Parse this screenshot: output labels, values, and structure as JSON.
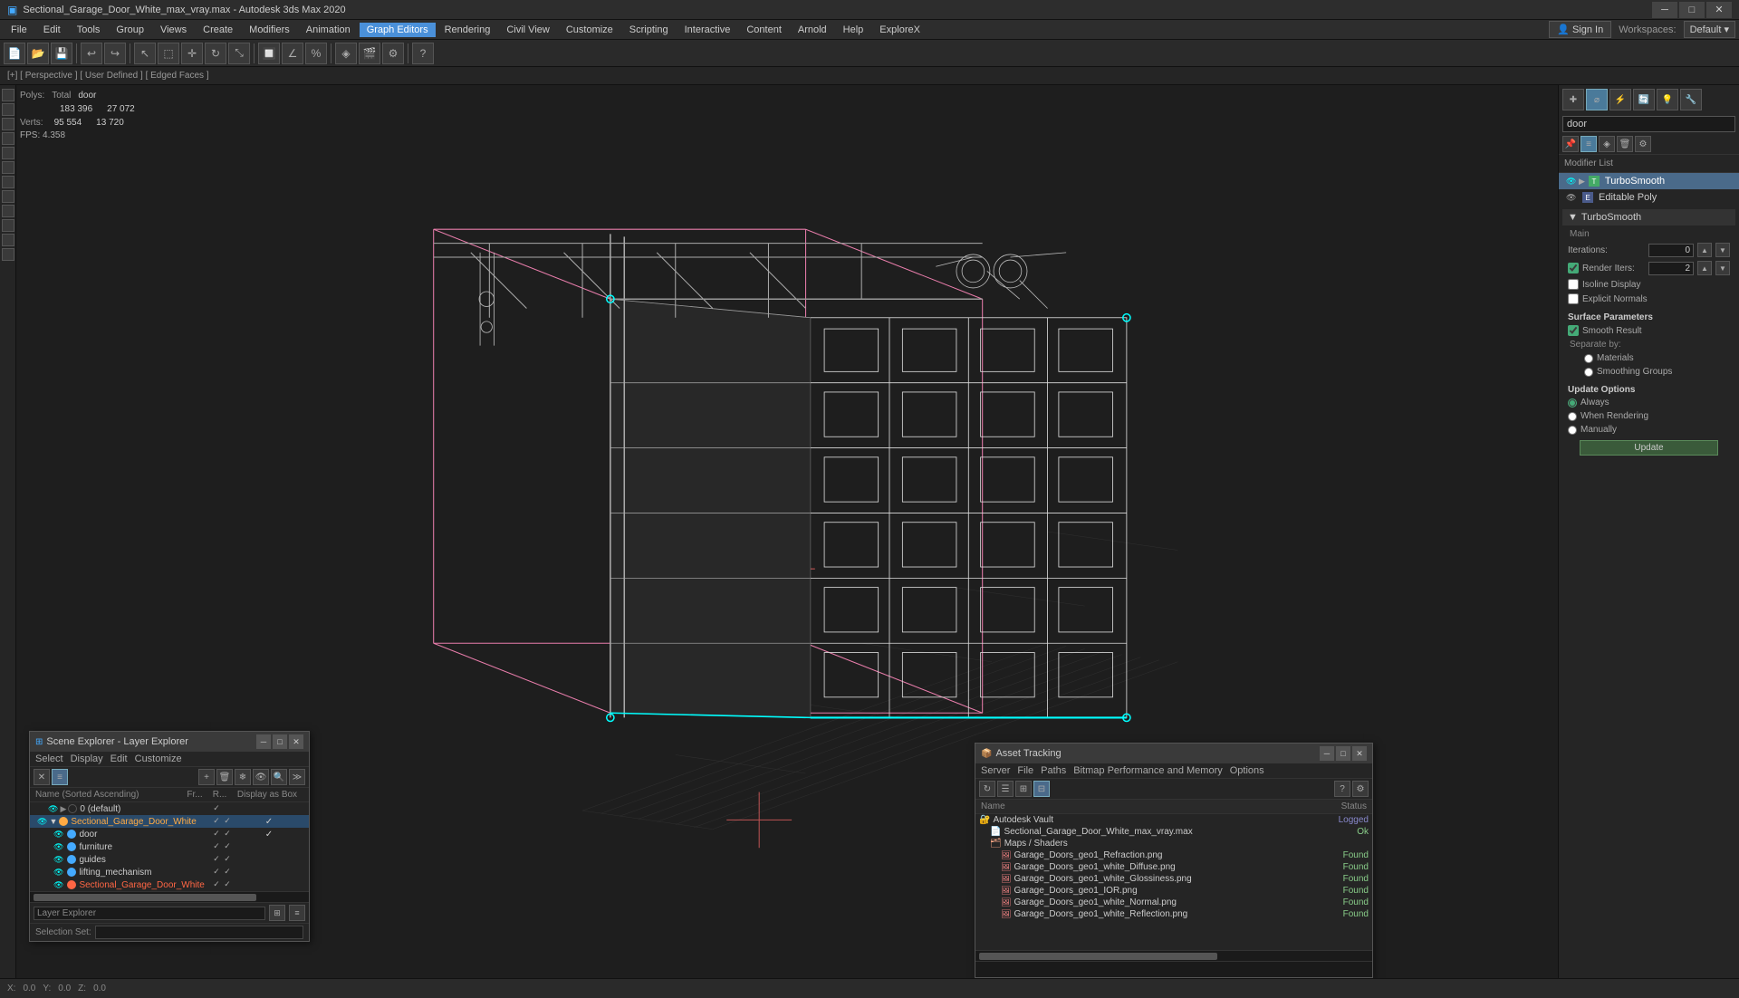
{
  "titlebar": {
    "title": "Sectional_Garage_Door_White_max_vray.max - Autodesk 3ds Max 2020",
    "icon": "🔷",
    "controls": {
      "minimize": "─",
      "maximize": "□",
      "close": "✕"
    }
  },
  "menubar": {
    "items": [
      "File",
      "Edit",
      "Tools",
      "Group",
      "Views",
      "Create",
      "Modifiers",
      "Animation",
      "Graph Editors",
      "Rendering",
      "Civil View",
      "Customize",
      "Scripting",
      "Interactive",
      "Content",
      "Arnold",
      "Help",
      "ExploreX"
    ],
    "signin": "Sign In",
    "workspace_label": "Workspaces:",
    "workspace_value": "Default"
  },
  "stats": {
    "polys_label": "Polys:",
    "total_polys": "183 396",
    "door_polys": "27 072",
    "verts_label": "Verts:",
    "total_verts": "95 554",
    "door_verts": "13 720",
    "total_label": "Total",
    "door_label": "door",
    "fps_label": "FPS:",
    "fps_value": "4.358"
  },
  "viewport": {
    "label": "[+] [ Perspective ] [ User Defined ] [ Edged Faces ]"
  },
  "right_panel": {
    "search_placeholder": "door",
    "modifier_list_label": "Modifier List",
    "modifiers": [
      {
        "name": "TurboSmooth",
        "active": true
      },
      {
        "name": "Editable Poly",
        "active": false
      }
    ],
    "turbosmooth": {
      "main_label": "Main",
      "iterations_label": "Iterations:",
      "iterations_value": "0",
      "render_iters_label": "Render Iters:",
      "render_iters_value": "2",
      "isoline_display_label": "Isoline Display",
      "explicit_normals_label": "Explicit Normals",
      "surface_parameters_label": "Surface Parameters",
      "smooth_result_label": "Smooth Result",
      "separate_by_label": "Separate by:",
      "materials_label": "Materials",
      "smoothing_groups_label": "Smoothing Groups",
      "update_options_label": "Update Options",
      "always_label": "Always",
      "when_rendering_label": "When Rendering",
      "manually_label": "Manually",
      "update_btn": "Update",
      "section_label": "TurboSmooth"
    }
  },
  "scene_explorer": {
    "title": "Scene Explorer - Layer Explorer",
    "menus": [
      "Select",
      "Display",
      "Edit",
      "Customize"
    ],
    "columns": {
      "name": "Name (Sorted Ascending)",
      "fr": "Fr...",
      "r": "R...",
      "display": "Display as Box"
    },
    "rows": [
      {
        "name": "0 (default)",
        "indent": 16,
        "level": 1,
        "color": "none",
        "has_eye": true
      },
      {
        "name": "Sectional_Garage_Door_White",
        "indent": 8,
        "level": 0,
        "color": "orange",
        "has_eye": true,
        "expanded": true,
        "is_layer": true
      },
      {
        "name": "door",
        "indent": 24,
        "level": 2,
        "color": "blue",
        "has_eye": true
      },
      {
        "name": "furniture",
        "indent": 24,
        "level": 2,
        "color": "blue",
        "has_eye": true
      },
      {
        "name": "guides",
        "indent": 24,
        "level": 2,
        "color": "blue",
        "has_eye": true
      },
      {
        "name": "lifting_mechanism",
        "indent": 24,
        "level": 2,
        "color": "blue",
        "has_eye": true
      },
      {
        "name": "Sectional_Garage_Door_White",
        "indent": 24,
        "level": 2,
        "color": "red",
        "has_eye": true
      }
    ],
    "footer_label": "Layer Explorer",
    "selection_set_label": "Select",
    "selection_set_value": "Selection Set:"
  },
  "asset_tracking": {
    "title": "Asset Tracking",
    "menus": [
      "Server",
      "File",
      "Paths",
      "Bitmap Performance and Memory",
      "Options"
    ],
    "columns": {
      "name": "Name",
      "status": "Status"
    },
    "rows": [
      {
        "name": "Autodesk Vault",
        "indent": 0,
        "status": "Logged",
        "status_type": "logged",
        "is_group": true
      },
      {
        "name": "Sectional_Garage_Door_White_max_vray.max",
        "indent": 12,
        "status": "Ok",
        "status_type": "ok"
      },
      {
        "name": "Maps / Shaders",
        "indent": 12,
        "status": "",
        "is_group": true
      },
      {
        "name": "Garage_Doors_geo1_Refraction.png",
        "indent": 24,
        "status": "Found",
        "status_type": "found"
      },
      {
        "name": "Garage_Doors_geo1_white_Diffuse.png",
        "indent": 24,
        "status": "Found",
        "status_type": "found"
      },
      {
        "name": "Garage_Doors_geo1_white_Glossiness.png",
        "indent": 24,
        "status": "Found",
        "status_type": "found"
      },
      {
        "name": "Garage_Doors_geo1_IOR.png",
        "indent": 24,
        "status": "Found",
        "status_type": "found"
      },
      {
        "name": "Garage_Doors_geo1_white_Normal.png",
        "indent": 24,
        "status": "Found",
        "status_type": "found"
      },
      {
        "name": "Garage_Doors_geo1_white_Reflection.png",
        "indent": 24,
        "status": "Found",
        "status_type": "found"
      }
    ]
  },
  "bottom_bar": {
    "coord_label": "X:",
    "x_value": "0.0",
    "y_label": "Y:",
    "y_value": "0.0",
    "z_label": "Z:",
    "z_value": "0.0"
  }
}
